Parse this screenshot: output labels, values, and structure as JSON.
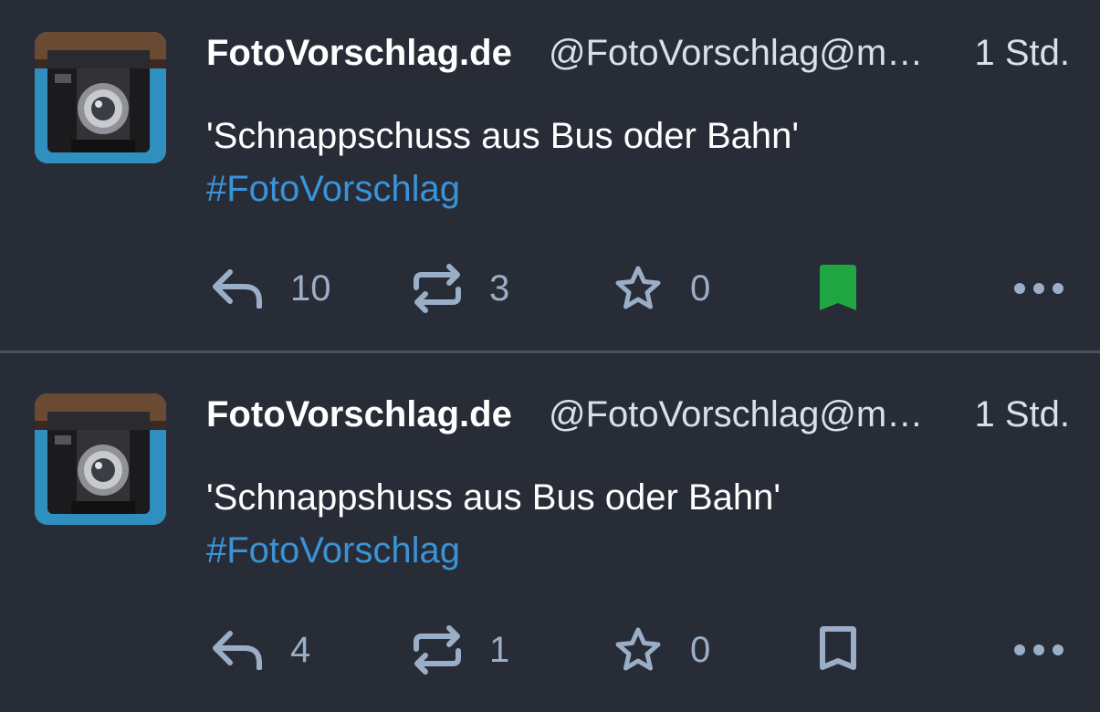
{
  "colors": {
    "background": "#282c37",
    "divider": "#4a5165",
    "hashtag": "#3a93d6",
    "icon": "#9baec8",
    "bookmark_active": "#1fa642"
  },
  "posts": [
    {
      "avatar_icon": "camera-photo-avatar",
      "display_name": "FotoVorschlag.de",
      "handle": "@FotoVorschlag@mastodon.social",
      "time": "1 Std.",
      "text": "'Schnappschuss aus Bus oder Bahn'",
      "hashtag": "#FotoVorschlag",
      "reply_count": "10",
      "boost_count": "3",
      "fav_count": "0",
      "bookmarked": true
    },
    {
      "avatar_icon": "camera-photo-avatar",
      "display_name": "FotoVorschlag.de",
      "handle": "@FotoVorschlag@mastodon.social",
      "time": "1 Std.",
      "text": "'Schnappshuss aus Bus oder Bahn'",
      "hashtag": "#FotoVorschlag",
      "reply_count": "4",
      "boost_count": "1",
      "fav_count": "0",
      "bookmarked": false
    }
  ]
}
